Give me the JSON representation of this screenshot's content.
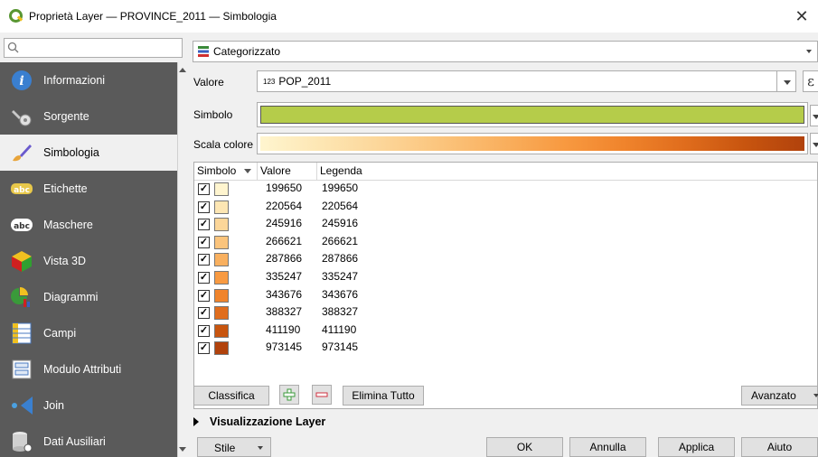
{
  "window": {
    "title": "Proprietà Layer — PROVINCE_2011 — Simbologia"
  },
  "sidebar": {
    "search_placeholder": "",
    "items": [
      {
        "label": "Informazioni",
        "icon": "info-icon"
      },
      {
        "label": "Sorgente",
        "icon": "source-icon"
      },
      {
        "label": "Simbologia",
        "icon": "symbology-brush-icon",
        "active": true
      },
      {
        "label": "Etichette",
        "icon": "labels-abc-icon"
      },
      {
        "label": "Maschere",
        "icon": "masks-abc-icon"
      },
      {
        "label": "Vista 3D",
        "icon": "3d-cube-icon"
      },
      {
        "label": "Diagrammi",
        "icon": "diagram-icon"
      },
      {
        "label": "Campi",
        "icon": "fields-icon"
      },
      {
        "label": "Modulo Attributi",
        "icon": "attributes-form-icon"
      },
      {
        "label": "Join",
        "icon": "join-icon"
      },
      {
        "label": "Dati Ausiliari",
        "icon": "auxiliary-data-icon"
      }
    ]
  },
  "main": {
    "renderer": "Categorizzato",
    "valore_label": "Valore",
    "valore_type_prefix": "123",
    "valore_field": "POP_2011",
    "expr_symbol": "ε",
    "simbolo_label": "Simbolo",
    "scala_label": "Scala colore",
    "symbol_color": "#b5cc4a",
    "table": {
      "headers": {
        "symbol": "Simbolo",
        "value": "Valore",
        "legend": "Legenda"
      },
      "rows": [
        {
          "value": "199650",
          "legend": "199650",
          "color": "#fff5cf",
          "checked": true
        },
        {
          "value": "220564",
          "legend": "220564",
          "color": "#fde6b3",
          "checked": true
        },
        {
          "value": "245916",
          "legend": "245916",
          "color": "#fcd699",
          "checked": true
        },
        {
          "value": "266621",
          "legend": "266621",
          "color": "#fbc47c",
          "checked": true
        },
        {
          "value": "287866",
          "legend": "287866",
          "color": "#f9b05f",
          "checked": true
        },
        {
          "value": "335247",
          "legend": "335247",
          "color": "#f89a41",
          "checked": true
        },
        {
          "value": "343676",
          "legend": "343676",
          "color": "#f0842c",
          "checked": true
        },
        {
          "value": "388327",
          "legend": "388327",
          "color": "#e06d1d",
          "checked": true
        },
        {
          "value": "411190",
          "legend": "411190",
          "color": "#c8550f",
          "checked": true
        },
        {
          "value": "973145",
          "legend": "973145",
          "color": "#b1420c",
          "checked": true
        }
      ]
    },
    "buttons": {
      "classifica": "Classifica",
      "elimina_tutto": "Elimina Tutto",
      "avanzato": "Avanzato"
    },
    "visualizzazione_layer": "Visualizzazione Layer"
  },
  "footer": {
    "stile": "Stile",
    "ok": "OK",
    "annulla": "Annulla",
    "applica": "Applica",
    "aiuto": "Aiuto"
  }
}
